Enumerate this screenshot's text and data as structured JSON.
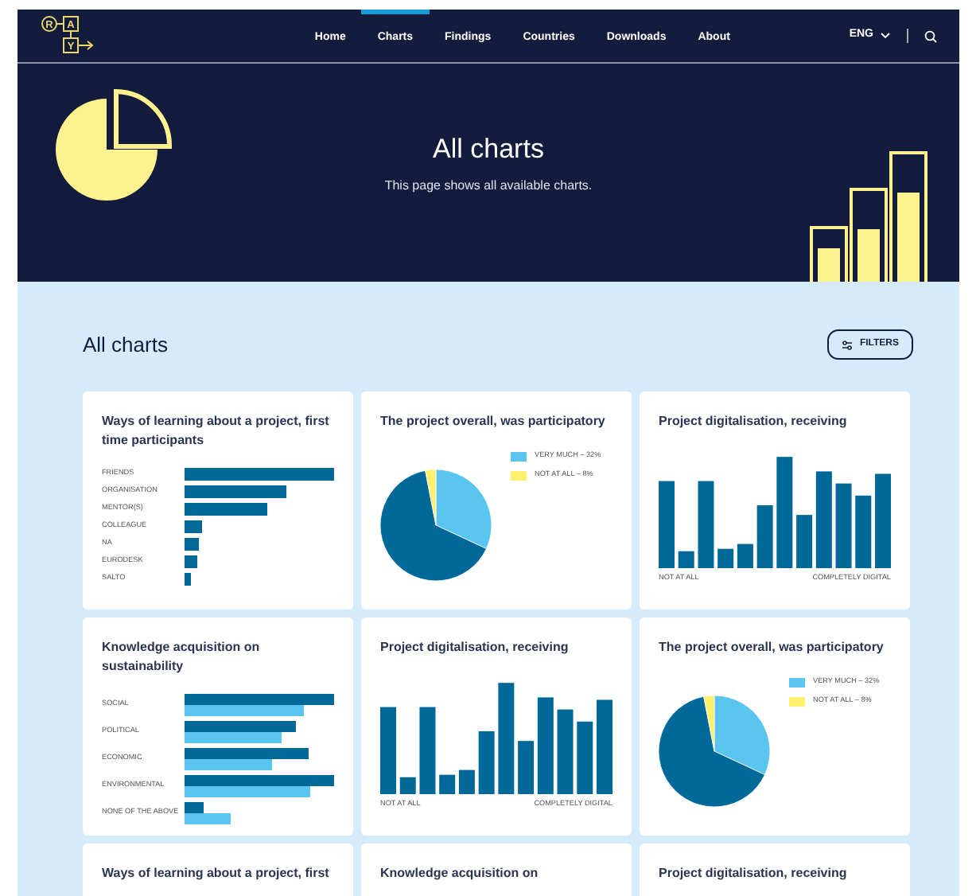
{
  "logo": {
    "letters": [
      "R",
      "A",
      "Y"
    ]
  },
  "nav": {
    "items": [
      {
        "label": "Home",
        "selected": false
      },
      {
        "label": "Charts",
        "selected": true
      },
      {
        "label": "Findings",
        "selected": false
      },
      {
        "label": "Countries",
        "selected": false
      },
      {
        "label": "Downloads",
        "selected": false
      },
      {
        "label": "About",
        "selected": false
      }
    ],
    "language": "ENG"
  },
  "hero": {
    "title": "All charts",
    "subtitle": "This page shows all available charts."
  },
  "section": {
    "title": "All charts",
    "filter_button": "FILTERS"
  },
  "cards": [
    {
      "kind": "hbar",
      "title": "Ways of learning about a project, first time participants",
      "labels": [
        "FRIENDS",
        "ORGANISATION",
        "MENTOR(S)",
        "COLLEAGUE",
        "NA",
        "EURODESK",
        "SALTO"
      ]
    },
    {
      "kind": "pie",
      "title": "The project overall, was participatory",
      "legend": [
        {
          "label": "VERY MUCH – 32%",
          "color": "#5bc5f2"
        },
        {
          "label": "NOT AT ALL – 8%",
          "color": "#fff06e"
        }
      ]
    },
    {
      "kind": "columns",
      "title": "Project digitalisation, receiving",
      "axis_start": "NOT AT ALL",
      "axis_end": "COMPLETELY DIGITAL"
    },
    {
      "kind": "grouped_hbar",
      "title": "Knowledge acquisition on sustainability",
      "labels": [
        "SOCIAL",
        "POLITICAL",
        "ECONOMIC",
        "ENVIRONMENTAL",
        "NONE OF THE ABOVE"
      ]
    },
    {
      "kind": "columns",
      "title": "Project digitalisation, receiving",
      "axis_start": "NOT AT ALL",
      "axis_end": "COMPLETELY DIGITAL"
    },
    {
      "kind": "pie",
      "title": "The project overall, was participatory",
      "legend": [
        {
          "label": "VERY MUCH – 32%",
          "color": "#5bc5f2"
        },
        {
          "label": "NOT AT ALL – 8%",
          "color": "#fff06e"
        }
      ]
    },
    {
      "kind": "cut",
      "title": "Ways of learning about a project, first"
    },
    {
      "kind": "cut",
      "title": "Knowledge acquisition on"
    },
    {
      "kind": "cut",
      "title": "Project digitalisation, receiving"
    }
  ]
}
